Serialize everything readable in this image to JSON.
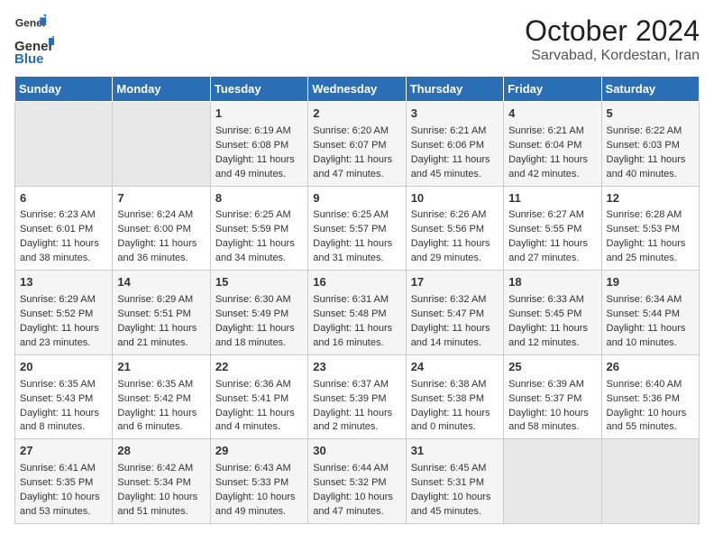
{
  "header": {
    "logo_line1": "General",
    "logo_line2": "Blue",
    "month": "October 2024",
    "location": "Sarvabad, Kordestan, Iran"
  },
  "days_of_week": [
    "Sunday",
    "Monday",
    "Tuesday",
    "Wednesday",
    "Thursday",
    "Friday",
    "Saturday"
  ],
  "weeks": [
    [
      {
        "day": "",
        "content": ""
      },
      {
        "day": "",
        "content": ""
      },
      {
        "day": "1",
        "sunrise": "Sunrise: 6:19 AM",
        "sunset": "Sunset: 6:08 PM",
        "daylight": "Daylight: 11 hours and 49 minutes."
      },
      {
        "day": "2",
        "sunrise": "Sunrise: 6:20 AM",
        "sunset": "Sunset: 6:07 PM",
        "daylight": "Daylight: 11 hours and 47 minutes."
      },
      {
        "day": "3",
        "sunrise": "Sunrise: 6:21 AM",
        "sunset": "Sunset: 6:06 PM",
        "daylight": "Daylight: 11 hours and 45 minutes."
      },
      {
        "day": "4",
        "sunrise": "Sunrise: 6:21 AM",
        "sunset": "Sunset: 6:04 PM",
        "daylight": "Daylight: 11 hours and 42 minutes."
      },
      {
        "day": "5",
        "sunrise": "Sunrise: 6:22 AM",
        "sunset": "Sunset: 6:03 PM",
        "daylight": "Daylight: 11 hours and 40 minutes."
      }
    ],
    [
      {
        "day": "6",
        "sunrise": "Sunrise: 6:23 AM",
        "sunset": "Sunset: 6:01 PM",
        "daylight": "Daylight: 11 hours and 38 minutes."
      },
      {
        "day": "7",
        "sunrise": "Sunrise: 6:24 AM",
        "sunset": "Sunset: 6:00 PM",
        "daylight": "Daylight: 11 hours and 36 minutes."
      },
      {
        "day": "8",
        "sunrise": "Sunrise: 6:25 AM",
        "sunset": "Sunset: 5:59 PM",
        "daylight": "Daylight: 11 hours and 34 minutes."
      },
      {
        "day": "9",
        "sunrise": "Sunrise: 6:25 AM",
        "sunset": "Sunset: 5:57 PM",
        "daylight": "Daylight: 11 hours and 31 minutes."
      },
      {
        "day": "10",
        "sunrise": "Sunrise: 6:26 AM",
        "sunset": "Sunset: 5:56 PM",
        "daylight": "Daylight: 11 hours and 29 minutes."
      },
      {
        "day": "11",
        "sunrise": "Sunrise: 6:27 AM",
        "sunset": "Sunset: 5:55 PM",
        "daylight": "Daylight: 11 hours and 27 minutes."
      },
      {
        "day": "12",
        "sunrise": "Sunrise: 6:28 AM",
        "sunset": "Sunset: 5:53 PM",
        "daylight": "Daylight: 11 hours and 25 minutes."
      }
    ],
    [
      {
        "day": "13",
        "sunrise": "Sunrise: 6:29 AM",
        "sunset": "Sunset: 5:52 PM",
        "daylight": "Daylight: 11 hours and 23 minutes."
      },
      {
        "day": "14",
        "sunrise": "Sunrise: 6:29 AM",
        "sunset": "Sunset: 5:51 PM",
        "daylight": "Daylight: 11 hours and 21 minutes."
      },
      {
        "day": "15",
        "sunrise": "Sunrise: 6:30 AM",
        "sunset": "Sunset: 5:49 PM",
        "daylight": "Daylight: 11 hours and 18 minutes."
      },
      {
        "day": "16",
        "sunrise": "Sunrise: 6:31 AM",
        "sunset": "Sunset: 5:48 PM",
        "daylight": "Daylight: 11 hours and 16 minutes."
      },
      {
        "day": "17",
        "sunrise": "Sunrise: 6:32 AM",
        "sunset": "Sunset: 5:47 PM",
        "daylight": "Daylight: 11 hours and 14 minutes."
      },
      {
        "day": "18",
        "sunrise": "Sunrise: 6:33 AM",
        "sunset": "Sunset: 5:45 PM",
        "daylight": "Daylight: 11 hours and 12 minutes."
      },
      {
        "day": "19",
        "sunrise": "Sunrise: 6:34 AM",
        "sunset": "Sunset: 5:44 PM",
        "daylight": "Daylight: 11 hours and 10 minutes."
      }
    ],
    [
      {
        "day": "20",
        "sunrise": "Sunrise: 6:35 AM",
        "sunset": "Sunset: 5:43 PM",
        "daylight": "Daylight: 11 hours and 8 minutes."
      },
      {
        "day": "21",
        "sunrise": "Sunrise: 6:35 AM",
        "sunset": "Sunset: 5:42 PM",
        "daylight": "Daylight: 11 hours and 6 minutes."
      },
      {
        "day": "22",
        "sunrise": "Sunrise: 6:36 AM",
        "sunset": "Sunset: 5:41 PM",
        "daylight": "Daylight: 11 hours and 4 minutes."
      },
      {
        "day": "23",
        "sunrise": "Sunrise: 6:37 AM",
        "sunset": "Sunset: 5:39 PM",
        "daylight": "Daylight: 11 hours and 2 minutes."
      },
      {
        "day": "24",
        "sunrise": "Sunrise: 6:38 AM",
        "sunset": "Sunset: 5:38 PM",
        "daylight": "Daylight: 11 hours and 0 minutes."
      },
      {
        "day": "25",
        "sunrise": "Sunrise: 6:39 AM",
        "sunset": "Sunset: 5:37 PM",
        "daylight": "Daylight: 10 hours and 58 minutes."
      },
      {
        "day": "26",
        "sunrise": "Sunrise: 6:40 AM",
        "sunset": "Sunset: 5:36 PM",
        "daylight": "Daylight: 10 hours and 55 minutes."
      }
    ],
    [
      {
        "day": "27",
        "sunrise": "Sunrise: 6:41 AM",
        "sunset": "Sunset: 5:35 PM",
        "daylight": "Daylight: 10 hours and 53 minutes."
      },
      {
        "day": "28",
        "sunrise": "Sunrise: 6:42 AM",
        "sunset": "Sunset: 5:34 PM",
        "daylight": "Daylight: 10 hours and 51 minutes."
      },
      {
        "day": "29",
        "sunrise": "Sunrise: 6:43 AM",
        "sunset": "Sunset: 5:33 PM",
        "daylight": "Daylight: 10 hours and 49 minutes."
      },
      {
        "day": "30",
        "sunrise": "Sunrise: 6:44 AM",
        "sunset": "Sunset: 5:32 PM",
        "daylight": "Daylight: 10 hours and 47 minutes."
      },
      {
        "day": "31",
        "sunrise": "Sunrise: 6:45 AM",
        "sunset": "Sunset: 5:31 PM",
        "daylight": "Daylight: 10 hours and 45 minutes."
      },
      {
        "day": "",
        "content": ""
      },
      {
        "day": "",
        "content": ""
      }
    ]
  ]
}
